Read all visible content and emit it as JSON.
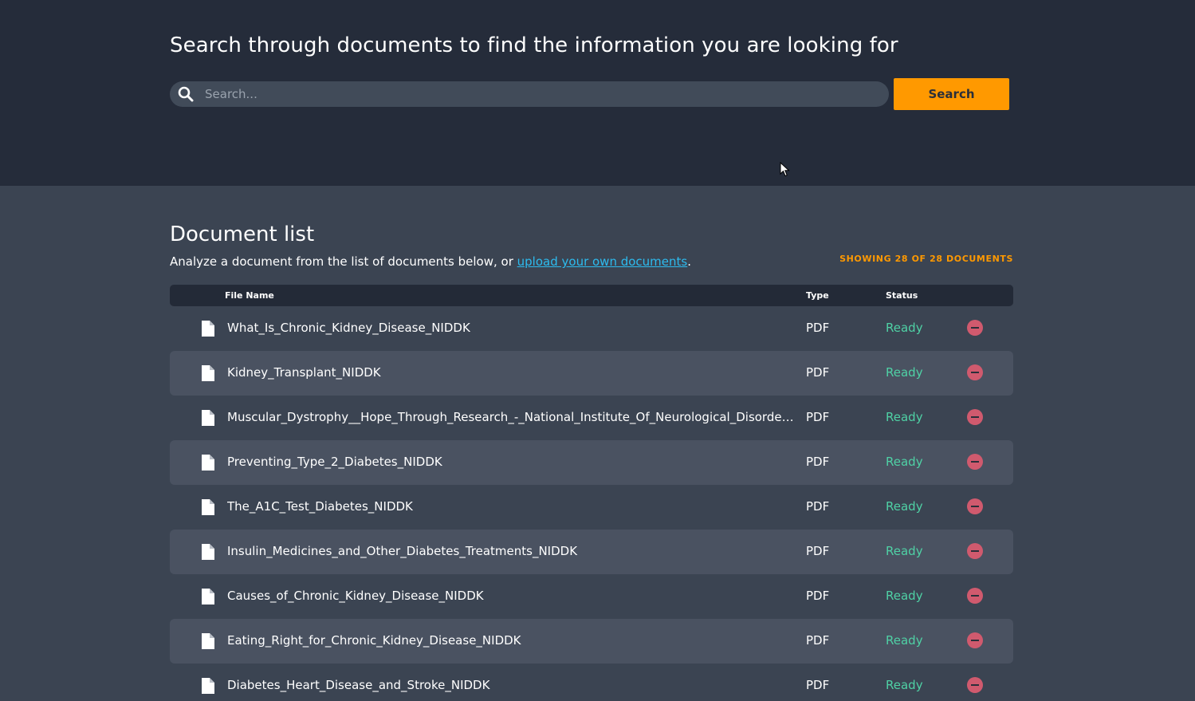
{
  "header": {
    "title": "Search through documents to find the information you are looking for",
    "search": {
      "placeholder": "Search...",
      "value": "",
      "button_label": "Search",
      "icon": "search-icon"
    }
  },
  "document_list": {
    "title": "Document list",
    "description_prefix": "Analyze a document from the list of documents below, or ",
    "upload_link_text": "upload your own documents",
    "description_suffix": ".",
    "showing_count": "SHOWING 28 OF 28 DOCUMENTS",
    "columns": {
      "file_name": "File Name",
      "type": "Type",
      "status": "Status"
    },
    "rows": [
      {
        "name": "What_Is_Chronic_Kidney_Disease_NIDDK",
        "type": "PDF",
        "status": "Ready"
      },
      {
        "name": "Kidney_Transplant_NIDDK",
        "type": "PDF",
        "status": "Ready"
      },
      {
        "name": "Muscular_Dystrophy__Hope_Through_Research_-_National_Institute_Of_Neurological_Disorders…",
        "type": "PDF",
        "status": "Ready"
      },
      {
        "name": "Preventing_Type_2_Diabetes_NIDDK",
        "type": "PDF",
        "status": "Ready"
      },
      {
        "name": "The_A1C_Test_Diabetes_NIDDK",
        "type": "PDF",
        "status": "Ready"
      },
      {
        "name": "Insulin_Medicines_and_Other_Diabetes_Treatments_NIDDK",
        "type": "PDF",
        "status": "Ready"
      },
      {
        "name": "Causes_of_Chronic_Kidney_Disease_NIDDK",
        "type": "PDF",
        "status": "Ready"
      },
      {
        "name": "Eating_Right_for_Chronic_Kidney_Disease_NIDDK",
        "type": "PDF",
        "status": "Ready"
      },
      {
        "name": "Diabetes_Heart_Disease_and_Stroke_NIDDK",
        "type": "PDF",
        "status": "Ready"
      }
    ]
  },
  "colors": {
    "header_bg": "#252c3a",
    "body_bg": "#3b4452",
    "accent": "#ff9900",
    "status_ready": "#4fd1a5",
    "link": "#2dbbee",
    "remove": "#d05a6e"
  }
}
